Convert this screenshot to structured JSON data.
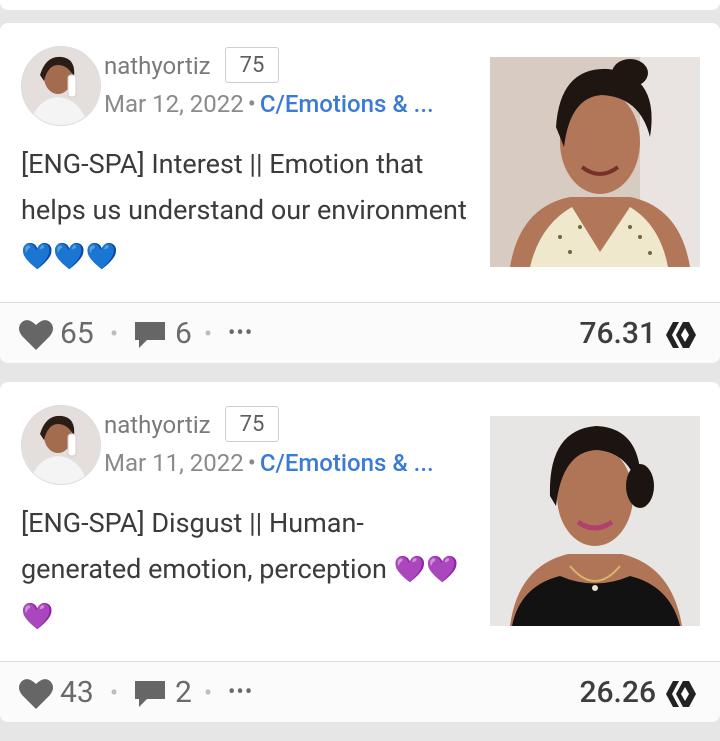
{
  "posts": [
    {
      "author": "nathyortiz",
      "reputation": "75",
      "date": "Mar 12, 2022",
      "separator": "•",
      "community": "C/Emotions & ...",
      "title": "[ENG-SPA] Interest || Emotion that helps us understand our environment",
      "title_emojis": "💙💙💙",
      "emoji_color": "#2b93e8",
      "votes": "65",
      "comments": "6",
      "more": "•••",
      "payout": "76.31",
      "icons": [
        "heart-icon",
        "comment-icon",
        "more-icon",
        "hive-icon"
      ]
    },
    {
      "author": "nathyortiz",
      "reputation": "75",
      "date": "Mar 11, 2022",
      "separator": "•",
      "community": "C/Emotions & ...",
      "title": "[ENG-SPA] Disgust || Human-generated emotion, perception",
      "title_emojis": "💜💜💜",
      "emoji_color": "#8c35c9",
      "votes": "43",
      "comments": "2",
      "more": "•••",
      "payout": "26.26",
      "icons": [
        "heart-icon",
        "comment-icon",
        "more-icon",
        "hive-icon"
      ]
    }
  ],
  "colors": {
    "community_link": "#3b7ad6",
    "background": "#e6e6e6",
    "card": "#ffffff"
  }
}
